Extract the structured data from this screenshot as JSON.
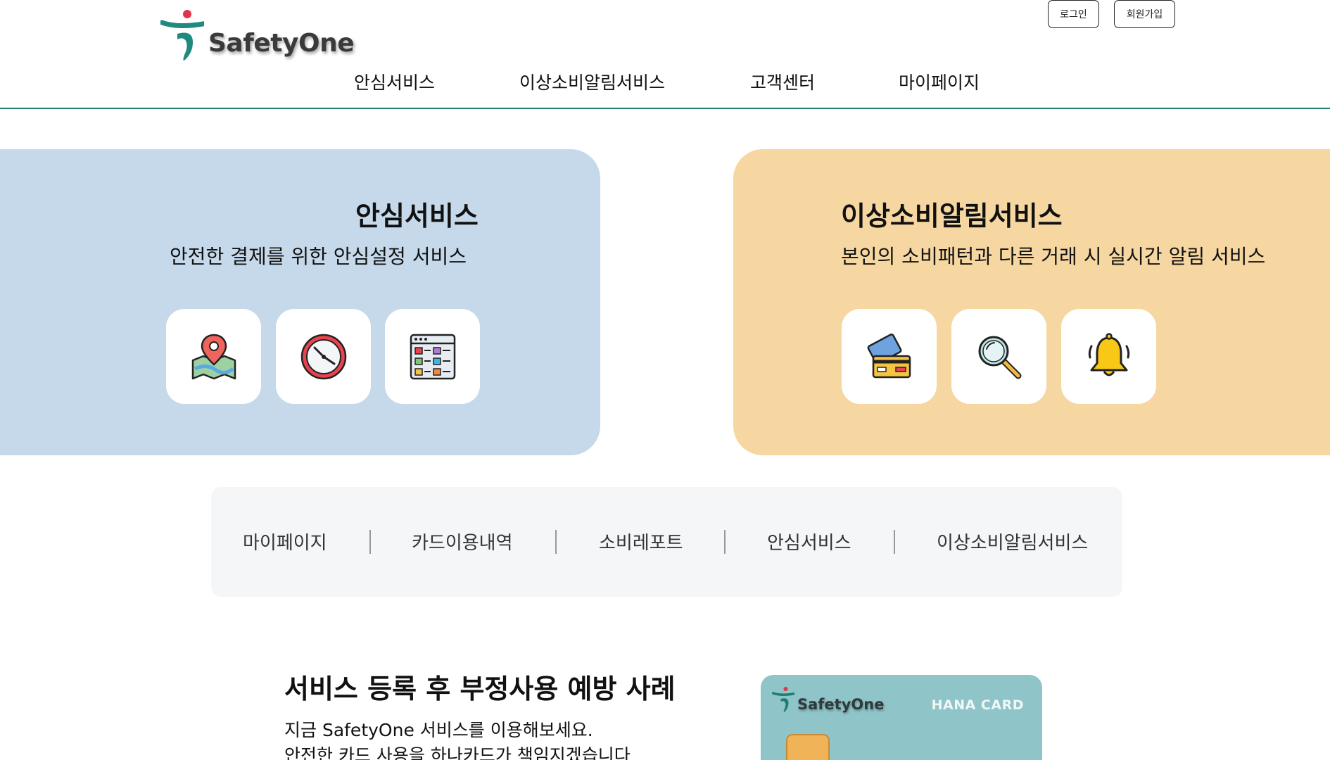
{
  "header": {
    "brand": "SafetyOne",
    "login_label": "로그인",
    "signup_label": "회원가입",
    "nav": [
      {
        "label": "안심서비스"
      },
      {
        "label": "이상소비알림서비스"
      },
      {
        "label": "고객센터"
      },
      {
        "label": "마이페이지"
      }
    ],
    "accent_color": "#1e7e74"
  },
  "safe_service": {
    "title": "안심서비스",
    "subtitle": "안전한 결제를 위한 안심설정 서비스",
    "bg_color": "#c6d9eb",
    "icons": [
      "map-location-icon",
      "clock-icon",
      "checklist-icon"
    ]
  },
  "alert_service": {
    "title": "이상소비알림서비스",
    "subtitle": "본인의 소비패턴과 다른 거래 시 실시간 알림 서비스",
    "bg_color": "#f6d7a1",
    "icons": [
      "credit-card-icon",
      "magnifier-icon",
      "bell-icon"
    ]
  },
  "quick_menu": [
    {
      "label": "마이페이지"
    },
    {
      "label": "카드이용내역"
    },
    {
      "label": "소비레포트"
    },
    {
      "label": "안심서비스"
    },
    {
      "label": "이상소비알림서비스"
    }
  ],
  "fraud_cases": {
    "title": "서비스 등록 후 부정사용 예방 사례",
    "line1": "지금 SafetyOne 서비스를 이용해보세요.",
    "line2": "안전한 카드 사용을 하나카드가 책임지겠습니다"
  },
  "card": {
    "brand": "SafetyOne",
    "issuer": "HANA CARD",
    "color": "#8fc4c8"
  }
}
